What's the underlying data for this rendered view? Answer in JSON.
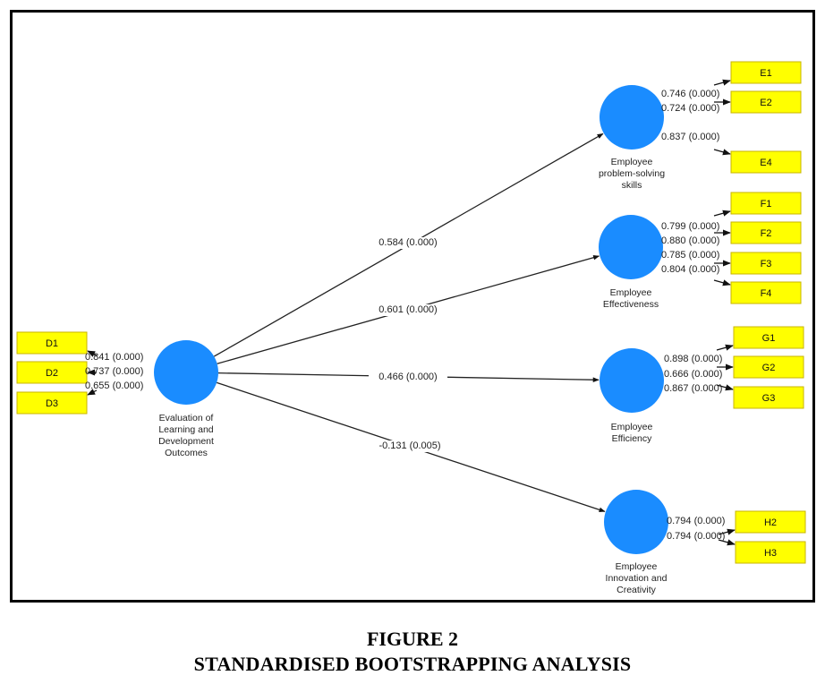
{
  "caption": {
    "figure_number": "FIGURE 2",
    "title": "STANDARDISED BOOTSTRAPPING ANALYSIS"
  },
  "colors": {
    "construct_fill": "#1a8cff",
    "indicator_fill": "#ffff00",
    "indicator_border": "#c8b400",
    "path_stroke": "#222222"
  },
  "constructs": [
    {
      "id": "D",
      "label_lines": [
        "Evaluation of",
        "Learning and",
        "Development",
        "Outcomes"
      ],
      "indicator_side": "left",
      "indicators": [
        {
          "name": "D1",
          "loading": "0.841 (0.000)"
        },
        {
          "name": "D2",
          "loading": "0.737 (0.000)"
        },
        {
          "name": "D3",
          "loading": "0.655 (0.000)"
        }
      ]
    },
    {
      "id": "E",
      "label_lines": [
        "Employee",
        "problem-solving",
        "skills"
      ],
      "indicator_side": "right",
      "indicators": [
        {
          "name": "E1",
          "loading": "0.746 (0.000)"
        },
        {
          "name": "E2",
          "loading": "0.724 (0.000)"
        },
        {
          "name": "E4",
          "loading": "0.837 (0.000)"
        }
      ]
    },
    {
      "id": "F",
      "label_lines": [
        "Employee",
        "Effectiveness"
      ],
      "indicator_side": "right",
      "indicators": [
        {
          "name": "F1",
          "loading": "0.799 (0.000)"
        },
        {
          "name": "F2",
          "loading": "0.880 (0.000)"
        },
        {
          "name": "F3",
          "loading": "0.785 (0.000)"
        },
        {
          "name": "F4",
          "loading": "0.804 (0.000)"
        }
      ]
    },
    {
      "id": "G",
      "label_lines": [
        "Employee",
        "Efficiency"
      ],
      "indicator_side": "right",
      "indicators": [
        {
          "name": "G1",
          "loading": "0.898 (0.000)"
        },
        {
          "name": "G2",
          "loading": "0.666 (0.000)"
        },
        {
          "name": "G3",
          "loading": "0.867 (0.000)"
        }
      ]
    },
    {
      "id": "H",
      "label_lines": [
        "Employee",
        "Innovation and",
        "Creativity"
      ],
      "indicator_side": "right",
      "indicators": [
        {
          "name": "H2",
          "loading": "0.794 (0.000)"
        },
        {
          "name": "H3",
          "loading": "0.794 (0.000)"
        }
      ]
    }
  ],
  "paths": [
    {
      "from": "D",
      "to": "E",
      "coefficient": "0.584 (0.000)"
    },
    {
      "from": "D",
      "to": "F",
      "coefficient": "0.601 (0.000)"
    },
    {
      "from": "D",
      "to": "G",
      "coefficient": "0.466 (0.000)"
    },
    {
      "from": "D",
      "to": "H",
      "coefficient": "-0.131 (0.005)"
    }
  ]
}
